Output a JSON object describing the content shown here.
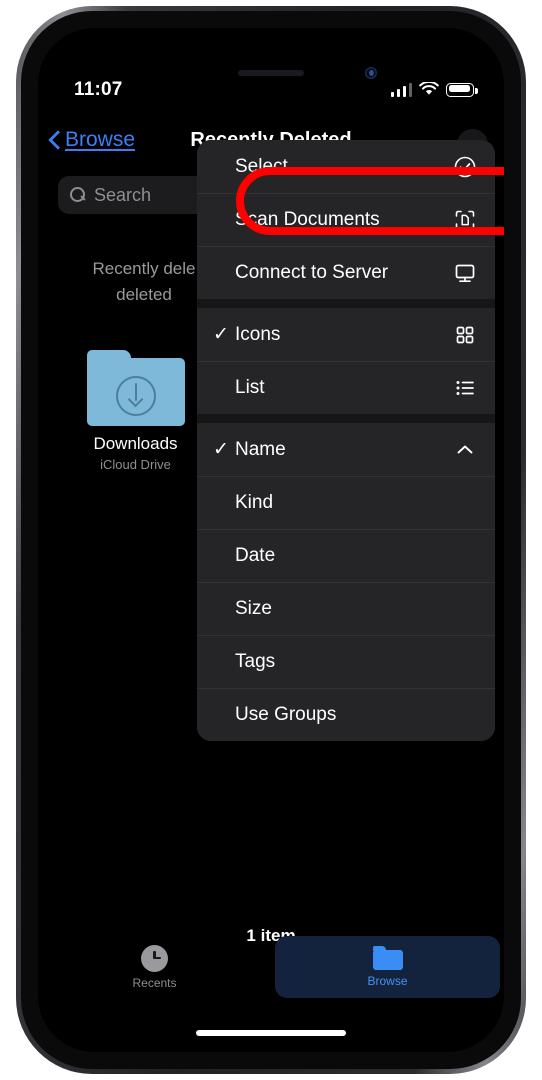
{
  "status_bar": {
    "time": "11:07",
    "cellular_icon": "cellular-bars-icon",
    "wifi_icon": "wifi-icon",
    "battery_icon": "battery-icon"
  },
  "nav_bar": {
    "back_label": "Browse",
    "back_icon": "chevron-left-icon",
    "title": "Recently Deleted",
    "more_icon": "ellipsis-circle-icon"
  },
  "search": {
    "placeholder": "Search",
    "icon": "magnifying-glass-icon"
  },
  "content": {
    "empty_message": "Recently dele\ndeleted",
    "item": {
      "name": "Downloads",
      "subtitle": "iCloud Drive",
      "icon": "downloads-folder-icon"
    },
    "item_count": "1 item"
  },
  "context_menu": {
    "groups": [
      {
        "rows": [
          {
            "label": "Select",
            "checked": false,
            "icon": "checkmark-circle-icon",
            "highlighted": true
          },
          {
            "label": "Scan Documents",
            "checked": false,
            "icon": "document-scanner-icon",
            "highlighted": false
          },
          {
            "label": "Connect to Server",
            "checked": false,
            "icon": "display-icon",
            "highlighted": false
          }
        ]
      },
      {
        "rows": [
          {
            "label": "Icons",
            "checked": true,
            "icon": "grid-view-icon",
            "highlighted": false
          },
          {
            "label": "List",
            "checked": false,
            "icon": "list-view-icon",
            "highlighted": false
          }
        ]
      },
      {
        "rows": [
          {
            "label": "Name",
            "checked": true,
            "icon": "chevron-up-icon",
            "highlighted": false
          },
          {
            "label": "Kind",
            "checked": false,
            "icon": "",
            "highlighted": false
          },
          {
            "label": "Date",
            "checked": false,
            "icon": "",
            "highlighted": false
          },
          {
            "label": "Size",
            "checked": false,
            "icon": "",
            "highlighted": false
          },
          {
            "label": "Tags",
            "checked": false,
            "icon": "",
            "highlighted": false
          },
          {
            "label": "Use Groups",
            "checked": false,
            "icon": "",
            "highlighted": false
          }
        ]
      }
    ],
    "checkmark_glyph": "✓"
  },
  "tab_bar": {
    "tabs": [
      {
        "label": "Recents",
        "icon": "clock-icon",
        "active": false
      },
      {
        "label": "Browse",
        "icon": "folder-icon",
        "active": true
      }
    ]
  },
  "colors": {
    "accent_blue": "#3b7ff5",
    "highlight_red": "#fe0000",
    "menu_bg": "#252527",
    "folder_blue": "#7fb9da",
    "tab_active_bg": "#13233d"
  }
}
